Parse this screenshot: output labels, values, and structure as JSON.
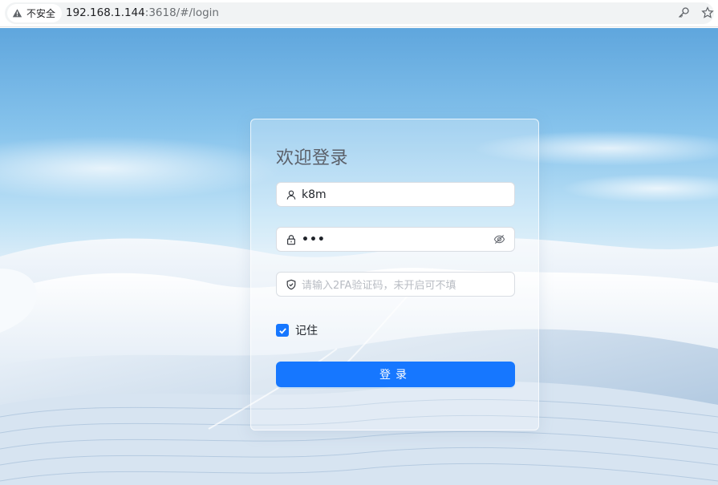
{
  "browser": {
    "security_label": "不安全",
    "url_host": "192.168.1.144",
    "url_rest": ":3618/#/login"
  },
  "login": {
    "title": "欢迎登录",
    "username_value": "k8m",
    "password_mask": "•••",
    "twofa_placeholder": "请输入2FA验证码，未开启可不填",
    "remember_label": "记住",
    "remember_checked": true,
    "submit_label": "登录"
  },
  "colors": {
    "accent": "#1677ff",
    "title": "#5b6069"
  },
  "icons": {
    "security": "warning-icon",
    "key": "key-icon",
    "star": "star-icon",
    "username": "user-icon",
    "password": "lock-icon",
    "password_toggle": "eye-off-icon",
    "twofa": "shield-icon",
    "remember": "checkmark-icon"
  }
}
